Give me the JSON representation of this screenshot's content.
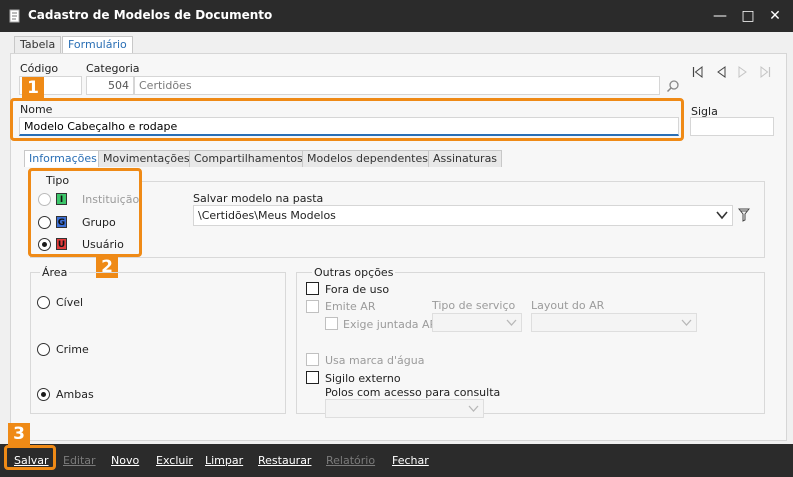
{
  "window": {
    "title": "Cadastro de Modelos de Documento",
    "icons": [
      "app-document-icon",
      "minimize-icon",
      "maximize-icon",
      "close-icon"
    ]
  },
  "top_tabs": [
    {
      "label": "Tabela",
      "active": false
    },
    {
      "label": "Formulário",
      "active": true
    }
  ],
  "header": {
    "codigo_label": "Código",
    "categoria_label": "Categoria",
    "categoria_code": "504",
    "categoria_name": "Certidões",
    "nome_label": "Nome",
    "nome_value": "Modelo Cabeçalho e rodape",
    "sigla_label": "Sigla",
    "sigla_value": ""
  },
  "callouts": [
    "1",
    "2",
    "3"
  ],
  "sub_tabs": [
    {
      "label": "Informações",
      "active": true
    },
    {
      "label": "Movimentações",
      "active": false
    },
    {
      "label": "Compartilhamentos",
      "active": false
    },
    {
      "label": "Modelos dependentes",
      "active": false
    },
    {
      "label": "Assinaturas",
      "active": false
    }
  ],
  "tipo": {
    "legend": "Tipo",
    "options": [
      {
        "label": "Instituição",
        "icon_letter": "I",
        "color": "#3cc66a",
        "disabled": true,
        "checked": false
      },
      {
        "label": "Grupo",
        "icon_letter": "G",
        "color": "#3b6fd6",
        "disabled": false,
        "checked": false
      },
      {
        "label": "Usuário",
        "icon_letter": "U",
        "color": "#e23b3b",
        "disabled": false,
        "checked": true
      }
    ]
  },
  "pasta": {
    "label": "Salvar modelo na pasta",
    "value": "\\Certidões\\Meus Modelos"
  },
  "area": {
    "legend": "Área",
    "options": [
      {
        "label": "Cível",
        "checked": false
      },
      {
        "label": "Crime",
        "checked": false
      },
      {
        "label": "Ambas",
        "checked": true
      }
    ]
  },
  "outras": {
    "legend": "Outras opções",
    "fora_de_uso": "Fora de uso",
    "emite_ar": "Emite AR",
    "exige_juntada_ar": "Exige juntada AR",
    "tipo_servico_label": "Tipo de serviço",
    "layout_ar_label": "Layout do AR",
    "usa_marca_dagua": "Usa marca d'água",
    "sigilo_externo": "Sigilo externo",
    "polos_label": "Polos com acesso para consulta"
  },
  "footer_buttons": [
    {
      "label": "Salvar",
      "enabled": true
    },
    {
      "label": "Editar",
      "enabled": false
    },
    {
      "label": "Novo",
      "enabled": true
    },
    {
      "label": "Excluir",
      "enabled": true
    },
    {
      "label": "Limpar",
      "enabled": true
    },
    {
      "label": "Restaurar",
      "enabled": true
    },
    {
      "label": "Relatório",
      "enabled": false
    },
    {
      "label": "Fechar",
      "enabled": true
    }
  ],
  "colors": {
    "callout": "#ef8a16",
    "titlebar": "#2b2b2b",
    "active_tab_text": "#2a6fb5"
  }
}
